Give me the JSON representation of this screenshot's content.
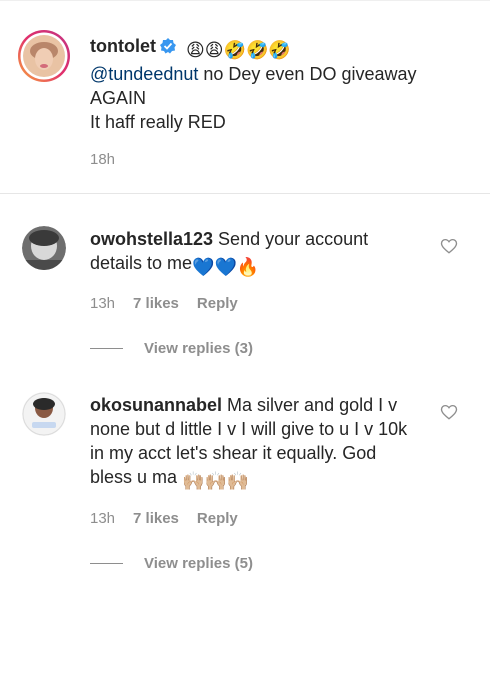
{
  "caption": {
    "username": "tontolet",
    "emojis": "😩😩🤣🤣🤣",
    "mention": "@tundeednut",
    "text_line1": " no Dey even DO giveaway",
    "text_line2": "AGAIN",
    "text_line3": "It haff really RED",
    "time": "18h"
  },
  "comments": [
    {
      "username": "owohstella123",
      "text": " Send your account details to me",
      "emojis": "💙💙🔥",
      "time": "13h",
      "likes": "7 likes",
      "reply_label": "Reply",
      "view_replies": "View replies (3)"
    },
    {
      "username": "okosunannabel",
      "text": " Ma silver and gold I v none but d little I v I will give to u I v 10k in my acct let's shear it equally. God bless u ma",
      "emojis": "🙌🏼🙌🏼🙌🏼",
      "time": "13h",
      "likes": "7 likes",
      "reply_label": "Reply",
      "view_replies": "View replies (5)"
    }
  ],
  "colors": {
    "text": "#262626",
    "secondary": "#8e8e8e",
    "mention": "#00376b",
    "verified": "#3897f0"
  }
}
